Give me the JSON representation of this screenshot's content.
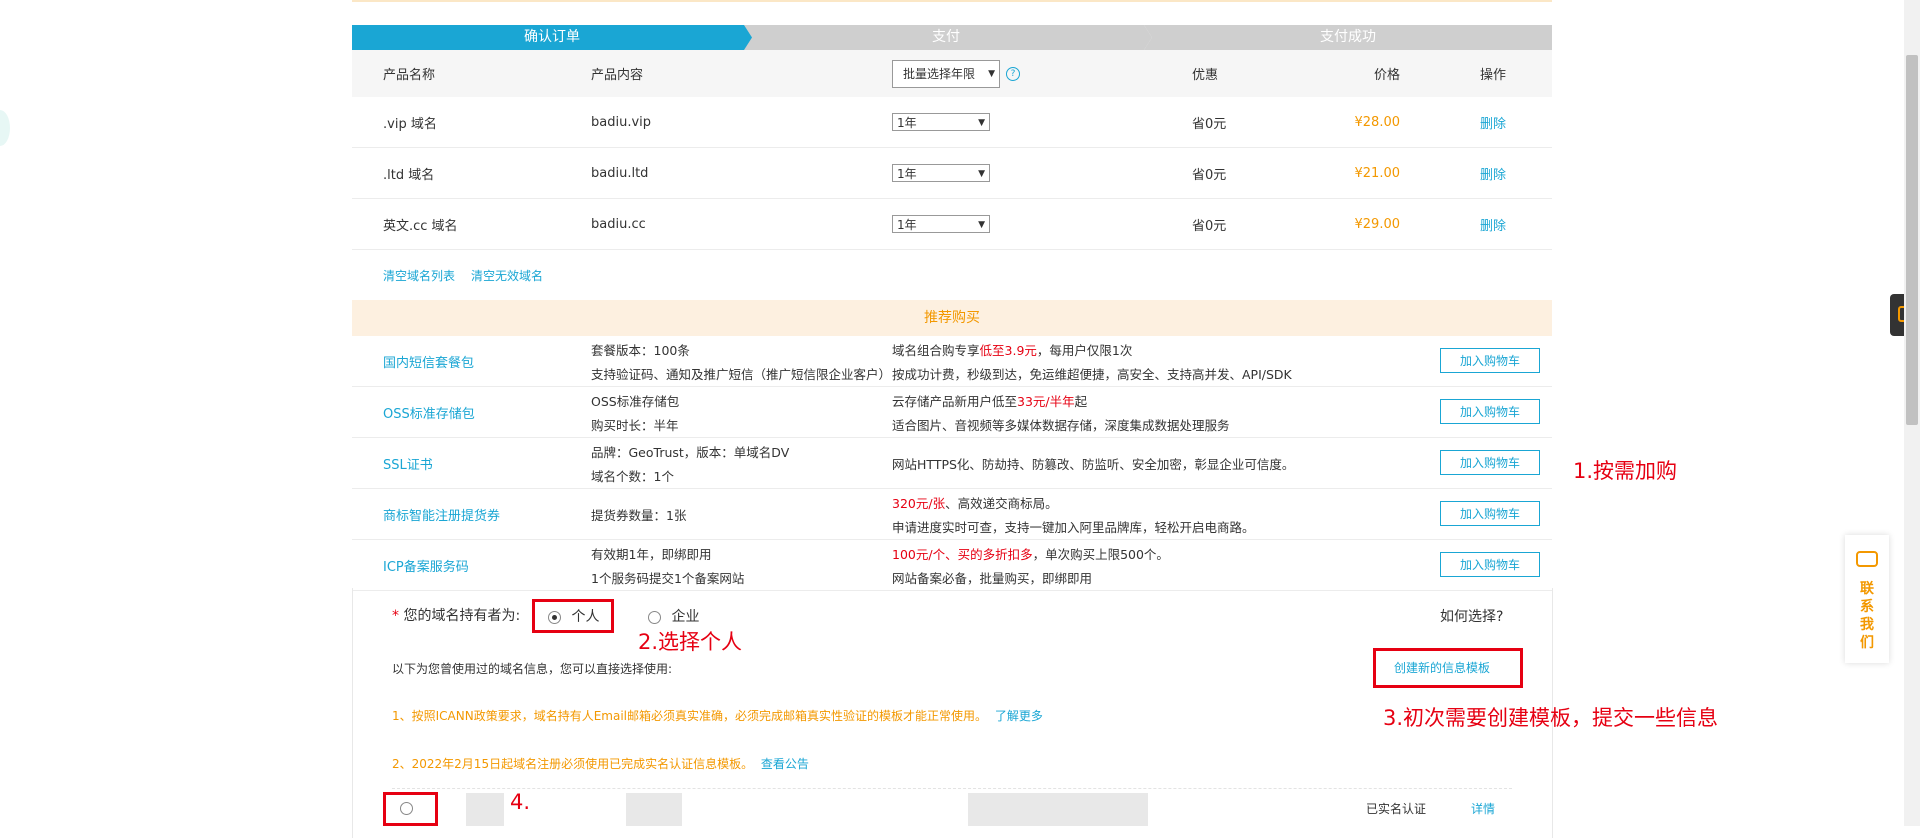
{
  "steps": [
    "确认订单",
    "支付",
    "支付成功"
  ],
  "table": {
    "headers": {
      "name": "产品名称",
      "content": "产品内容",
      "batch": "批量选择年限",
      "discount": "优惠",
      "price": "价格",
      "action": "操作"
    },
    "rows": [
      {
        "name": ".vip 域名",
        "content": "badiu.vip",
        "years": "1年",
        "discount": "省0元",
        "price": "¥28.00",
        "action": "删除"
      },
      {
        "name": ".ltd 域名",
        "content": "badiu.ltd",
        "years": "1年",
        "discount": "省0元",
        "price": "¥21.00",
        "action": "删除"
      },
      {
        "name": "英文.cc 域名",
        "content": "badiu.cc",
        "years": "1年",
        "discount": "省0元",
        "price": "¥29.00",
        "action": "删除"
      }
    ],
    "clear_list": "清空域名列表",
    "clear_invalid": "清空无效域名"
  },
  "recommend": {
    "title": "推荐购买",
    "cart_label": "加入购物车",
    "items": [
      {
        "name": "国内短信套餐包",
        "spec1": "套餐版本：100条",
        "spec2": "支持验证码、通知及推广短信（推广短信限企业客户）",
        "desc1_a": "域名组合购专享",
        "desc1_red": "低至3.9元",
        "desc1_b": "，每用户仅限1次",
        "desc2": "按成功计费，秒级到达，免运维超便捷，高安全、支持高并发、API/SDK"
      },
      {
        "name": "OSS标准存储包",
        "spec1": "OSS标准存储包",
        "spec2": "购买时长：半年",
        "desc1_a": "云存储产品新用户低至",
        "desc1_red": "33元/半年",
        "desc1_b": "起",
        "desc2": "适合图片、音视频等多媒体数据存储，深度集成数据处理服务"
      },
      {
        "name": "SSL证书",
        "spec1": "品牌：GeoTrust，版本：单域名DV",
        "spec2": "域名个数：1个",
        "desc_single": "网站HTTPS化、防劫持、防篡改、防监听、安全加密，彰显企业可信度。"
      },
      {
        "name": "商标智能注册提货券",
        "spec_single": "提货券数量：1张",
        "desc1_a": "",
        "desc1_red": "320元/张",
        "desc1_b": "、高效递交商标局。",
        "desc2": "申请进度实时可查，支持一键加入阿里品牌库，轻松开启电商路。"
      },
      {
        "name": "ICP备案服务码",
        "spec1": "有效期1年，即绑即用",
        "spec2": "1个服务码提交1个备案网站",
        "desc1_a": "",
        "desc1_red": "100元/个、买的多折扣多",
        "desc1_b": "，单次购买上限500个。",
        "desc2": "网站备案必备，批量购买，即绑即用"
      }
    ]
  },
  "holder": {
    "label": "您的域名持有者为:",
    "required_mark": "*",
    "personal": "个人",
    "company": "企业",
    "how_to_choose": "如何选择?",
    "intro": "以下为您曾使用过的域名信息，您可以直接选择使用:",
    "create_template": "创建新的信息模板",
    "notice1": "1、按照ICANN政策要求，域名持有人Email邮箱必须真实准确，必须完成邮箱真实性验证的模板才能正常使用。",
    "notice1_link": "了解更多",
    "notice2": "2、2022年2月15日起域名注册必须使用已完成实名认证信息模板。",
    "notice2_link": "查看公告",
    "verified": "已实名认证",
    "details": "详情"
  },
  "annotations": {
    "a1": "1.按需加购",
    "a2": "2.选择个人",
    "a3": "3.初次需要创建模板，提交一些信息",
    "a4": "4."
  },
  "contact": "联系我们",
  "colors": {
    "accent": "#1aa6d4",
    "price": "#f39800",
    "annotation": "#e60012"
  }
}
